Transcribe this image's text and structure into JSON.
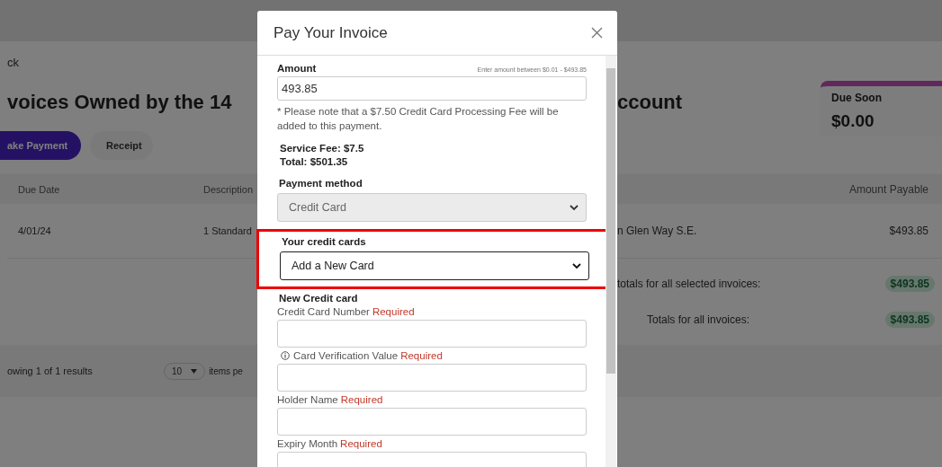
{
  "page": {
    "back_link": "ck",
    "title": "voices Owned by the 14",
    "title_end": "ccount",
    "buttons": [
      {
        "label": "ake Payment",
        "kind": "primary"
      },
      {
        "label": "Receipt",
        "kind": "secondary"
      }
    ],
    "due_card": {
      "label": "Due Soon",
      "value": "$0.00"
    },
    "table": {
      "columns": [
        "Due Date",
        "Description",
        "Amount Payable"
      ],
      "rows": [
        {
          "due_date": "4/01/24",
          "description": "1 Standard",
          "address": "n Glen Way S.E.",
          "amount": "$493.85"
        }
      ],
      "totals": [
        {
          "label": "totals for all selected invoices:",
          "value": "$493.85"
        },
        {
          "label": "Totals for all invoices:",
          "value": "$493.85"
        }
      ]
    },
    "pager": {
      "summary": "owing 1 of 1 results",
      "page_size": "10",
      "suffix": "items pe"
    }
  },
  "modal": {
    "title": "Pay Your Invoice",
    "amount": {
      "label": "Amount",
      "hint": "Enter amount between $0.01 - $493.85",
      "value": "493.85",
      "note": "* Please note that a $7.50 Credit Card Processing Fee will be added to this payment."
    },
    "summary": [
      "Service Fee: $7.5",
      "Total: $501.35"
    ],
    "payment_method": {
      "label": "Payment method",
      "value": "Credit Card",
      "disabled": true
    },
    "credit_cards": {
      "label": "Your credit cards",
      "value": "Add a New Card",
      "highlighted": true
    },
    "new_card": {
      "heading": "New Credit card",
      "fields": [
        {
          "label": "Credit Card Number",
          "required": "Required",
          "info": false
        },
        {
          "label": "Card Verification Value",
          "required": "Required",
          "info": true
        },
        {
          "label": "Holder Name",
          "required": "Required",
          "info": false
        },
        {
          "label": "Expiry Month",
          "required": "Required",
          "info": false
        }
      ]
    }
  }
}
